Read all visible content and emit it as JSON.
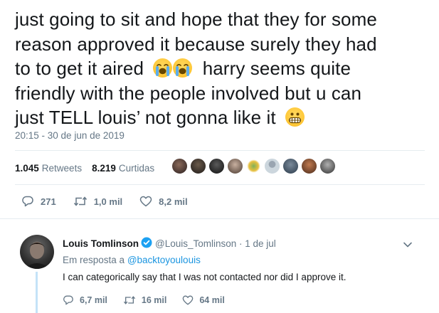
{
  "tweet": {
    "lines": [
      "just going to sit and hope that they for some",
      "reason approved it because surely they had",
      "to to get it aired",
      "harry seems quite",
      "friendly  with the people involved but u can",
      "just TELL louis’ not gonna like it"
    ],
    "timestamp": "20:15 - 30 de jun de 2019",
    "emoji": {
      "crying": "loudly-crying-face-icon",
      "grimacing": "grimacing-face-icon"
    }
  },
  "stats": {
    "retweets_count": "1.045",
    "retweets_label": "Retweets",
    "likes_count": "8.219",
    "likes_label": "Curtidas"
  },
  "actions": {
    "reply_count": "271",
    "retweet_count": "1,0 mil",
    "like_count": "8,2 mil"
  },
  "reply": {
    "name": "Louis Tomlinson",
    "handle_date": "@Louis_Tomlinson · 1 de jul",
    "in_reply_prefix": "Em resposta a",
    "in_reply_mention": "@backtoyoulouis",
    "text": "I can categorically say that I was not contacted nor did I approve it.",
    "reply_count": "6,7 mil",
    "retweet_count": "16 mil",
    "like_count": "64 mil"
  },
  "colors": {
    "text": "#14171a",
    "muted": "#657786",
    "link": "#1b95e0",
    "verified": "#1da1f2",
    "divider": "#e6ecf0",
    "thread": "#c4e3f8"
  }
}
